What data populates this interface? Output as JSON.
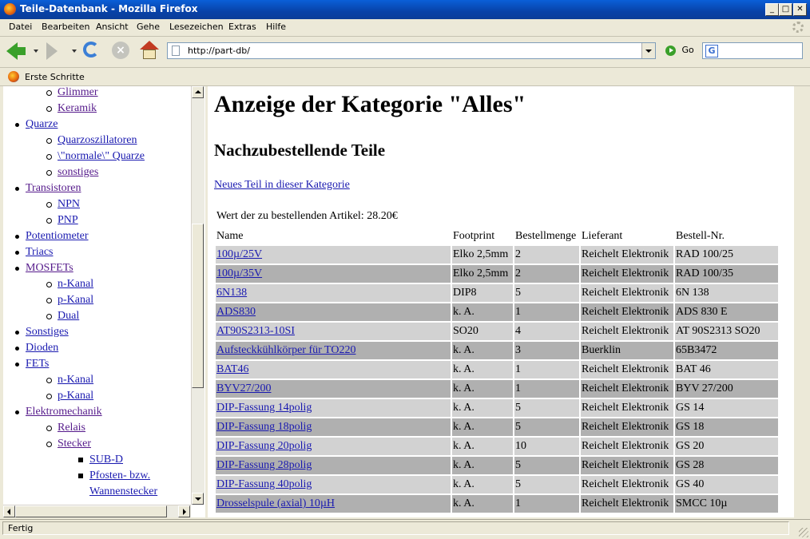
{
  "window": {
    "title": "Teile-Datenbank - Mozilla Firefox",
    "controls": {
      "minimize": "_",
      "maximize": "□",
      "close": "✕"
    }
  },
  "menu": [
    "Datei",
    "Bearbeiten",
    "Ansicht",
    "Gehe",
    "Lesezeichen",
    "Extras",
    "Hilfe"
  ],
  "navigation": {
    "url": "http://part-db/",
    "go_label": "Go",
    "search_engine_letter": "G"
  },
  "bookmarks": {
    "first": "Erste Schritte"
  },
  "sidebar_tree": [
    {
      "label": "Glimmer",
      "level": 2,
      "visited": true
    },
    {
      "label": "Keramik",
      "level": 2,
      "visited": true
    },
    {
      "label": "Quarze",
      "level": 1,
      "visited": false
    },
    {
      "label": "Quarzoszillatoren",
      "level": 2,
      "visited": false
    },
    {
      "label": "\\\"normale\\\" Quarze",
      "level": 2,
      "visited": false
    },
    {
      "label": "sonstiges",
      "level": 2,
      "visited": true
    },
    {
      "label": "Transistoren",
      "level": 1,
      "visited": true
    },
    {
      "label": "NPN",
      "level": 2,
      "visited": false
    },
    {
      "label": "PNP",
      "level": 2,
      "visited": false
    },
    {
      "label": "Potentiometer",
      "level": 1,
      "visited": false
    },
    {
      "label": "Triacs",
      "level": 1,
      "visited": false
    },
    {
      "label": "MOSFETs",
      "level": 1,
      "visited": true
    },
    {
      "label": "n-Kanal",
      "level": 2,
      "visited": false
    },
    {
      "label": "p-Kanal",
      "level": 2,
      "visited": false
    },
    {
      "label": "Dual",
      "level": 2,
      "visited": false
    },
    {
      "label": "Sonstiges",
      "level": 1,
      "visited": false
    },
    {
      "label": "Dioden",
      "level": 1,
      "visited": false
    },
    {
      "label": "FETs",
      "level": 1,
      "visited": false
    },
    {
      "label": "n-Kanal",
      "level": 2,
      "visited": false
    },
    {
      "label": "p-Kanal",
      "level": 2,
      "visited": false
    },
    {
      "label": "Elektromechanik",
      "level": 1,
      "visited": true
    },
    {
      "label": "Relais",
      "level": 2,
      "visited": true
    },
    {
      "label": "Stecker",
      "level": 2,
      "visited": true
    },
    {
      "label": "SUB-D",
      "level": 3,
      "visited": false
    },
    {
      "label": "Pfosten- bzw.",
      "level": 3,
      "visited": false
    },
    {
      "label": "Wannenstecker",
      "level": 3,
      "visited": false,
      "continuation": true
    }
  ],
  "content": {
    "heading": "Anzeige der Kategorie \"Alles\"",
    "subheading": "Nachzubestellende Teile",
    "new_part_link": "Neues Teil in dieser Kategorie",
    "order_total": "Wert der zu bestellenden Artikel: 28.20€",
    "columns": [
      "Name",
      "Footprint",
      "Bestellmenge",
      "Lieferant",
      "Bestell-Nr."
    ],
    "rows": [
      [
        "100µ/25V",
        "Elko 2,5mm",
        "2",
        "Reichelt Elektronik",
        "RAD 100/25"
      ],
      [
        "100µ/35V",
        "Elko 2,5mm",
        "2",
        "Reichelt Elektronik",
        "RAD 100/35"
      ],
      [
        "6N138",
        "DIP8",
        "5",
        "Reichelt Elektronik",
        "6N 138"
      ],
      [
        "ADS830",
        "k. A.",
        "1",
        "Reichelt Elektronik",
        "ADS 830 E"
      ],
      [
        "AT90S2313-10SI",
        "SO20",
        "4",
        "Reichelt Elektronik",
        "AT 90S2313 SO20"
      ],
      [
        "Aufsteckkühlkörper für TO220",
        "k. A.",
        "3",
        "Buerklin",
        "65B3472"
      ],
      [
        "BAT46",
        "k. A.",
        "1",
        "Reichelt Elektronik",
        "BAT 46"
      ],
      [
        "BYV27/200",
        "k. A.",
        "1",
        "Reichelt Elektronik",
        "BYV 27/200"
      ],
      [
        "DIP-Fassung 14polig",
        "k. A.",
        "5",
        "Reichelt Elektronik",
        "GS 14"
      ],
      [
        "DIP-Fassung 18polig",
        "k. A.",
        "5",
        "Reichelt Elektronik",
        "GS 18"
      ],
      [
        "DIP-Fassung 20polig",
        "k. A.",
        "10",
        "Reichelt Elektronik",
        "GS 20"
      ],
      [
        "DIP-Fassung 28polig",
        "k. A.",
        "5",
        "Reichelt Elektronik",
        "GS 28"
      ],
      [
        "DIP-Fassung 40polig",
        "k. A.",
        "5",
        "Reichelt Elektronik",
        "GS 40"
      ],
      [
        "Drosselspule (axial) 10µH",
        "k. A.",
        "1",
        "Reichelt Elektronik",
        "SMCC 10µ"
      ]
    ]
  },
  "status": {
    "text": "Fertig"
  }
}
